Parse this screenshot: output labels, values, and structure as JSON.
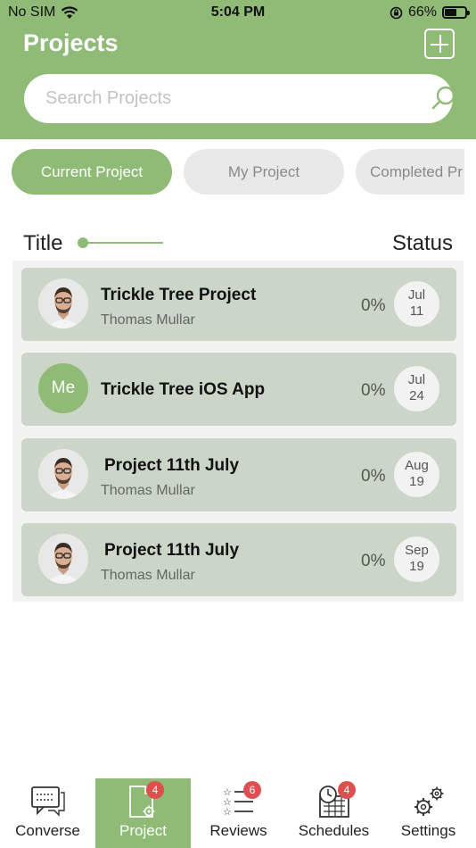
{
  "status_bar": {
    "carrier": "No SIM",
    "time": "5:04 PM",
    "battery": "66%",
    "battery_level": 0.66
  },
  "header": {
    "title": "Projects"
  },
  "search": {
    "placeholder": "Search Projects"
  },
  "tabs": [
    {
      "label": "Current Project",
      "active": true
    },
    {
      "label": "My Project",
      "active": false
    },
    {
      "label": "Completed Pr",
      "active": false
    }
  ],
  "columns": {
    "title": "Title",
    "status": "Status"
  },
  "projects": [
    {
      "name": "Trickle Tree Project",
      "owner": "Thomas Mullar",
      "progress": "0%",
      "month": "Jul",
      "day": "11",
      "avatar": "photo"
    },
    {
      "name": "Trickle Tree iOS App",
      "owner": "",
      "progress": "0%",
      "month": "Jul",
      "day": "24",
      "avatar": "Me"
    },
    {
      "name": "Project 11th July",
      "owner": "Thomas Mullar",
      "progress": "0%",
      "month": "Aug",
      "day": "19",
      "avatar": "photo"
    },
    {
      "name": "Project 11th July",
      "owner": "Thomas Mullar",
      "progress": "0%",
      "month": "Sep",
      "day": "19",
      "avatar": "photo"
    }
  ],
  "tabbar": [
    {
      "label": "Converse",
      "icon": "chat-icon",
      "badge": ""
    },
    {
      "label": "Project",
      "icon": "project-icon",
      "badge": "4",
      "active": true
    },
    {
      "label": "Reviews",
      "icon": "reviews-icon",
      "badge": "6"
    },
    {
      "label": "Schedules",
      "icon": "schedule-icon",
      "badge": "4"
    },
    {
      "label": "Settings",
      "icon": "gears-icon",
      "badge": ""
    }
  ],
  "colors": {
    "brand_green": "#8fbb76",
    "card_bg": "#cbd5c8",
    "badge_red": "#de4f4f"
  }
}
